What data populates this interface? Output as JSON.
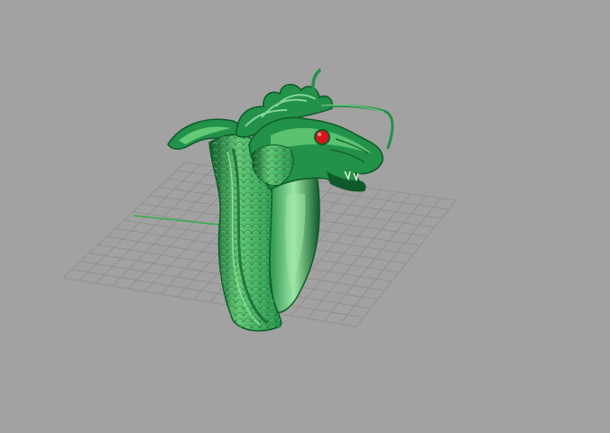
{
  "viewport": {
    "background": "#a2a2a2",
    "grid_color": "#8c8c8c",
    "axis_color": "#2fb04a"
  },
  "model": {
    "icon": "dragon-ring-model",
    "colors": {
      "dark": "#0f5a2a",
      "mid": "#22914a",
      "light": "#63c976",
      "highlight": "#9ee6a6",
      "eye": "#d9141c",
      "tooth": "#d8ecd0"
    }
  }
}
